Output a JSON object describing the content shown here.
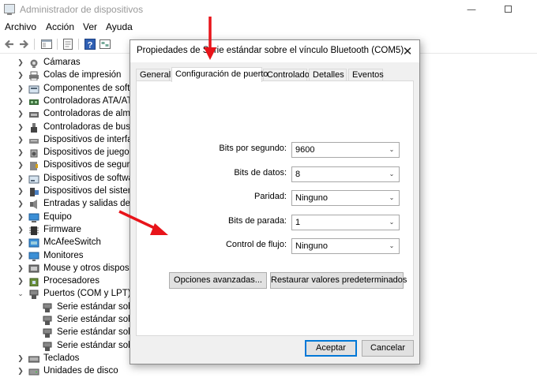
{
  "window": {
    "title": "Administrador de dispositivos",
    "minimize_glyph": "—",
    "close_glyph": "✕"
  },
  "menu": [
    "Archivo",
    "Acción",
    "Ver",
    "Ayuda"
  ],
  "toolbar_icons": [
    "back-arrow-icon",
    "forward-arrow-icon",
    "show-hide-tree-icon",
    "properties-icon",
    "help-icon",
    "device-view-icon"
  ],
  "tree": {
    "expand_glyph": "❯",
    "collapse_glyph": "⌄",
    "items": [
      {
        "label": "Cámaras",
        "icon": "camera-icon",
        "expanded": false
      },
      {
        "label": "Colas de impresión",
        "icon": "printer-icon",
        "expanded": false
      },
      {
        "label": "Componentes de softw",
        "icon": "software-component-icon",
        "expanded": false
      },
      {
        "label": "Controladoras ATA/ATA",
        "icon": "ata-controller-icon",
        "expanded": false
      },
      {
        "label": "Controladoras de alma",
        "icon": "storage-controller-icon",
        "expanded": false
      },
      {
        "label": "Controladoras de bus s",
        "icon": "usb-controller-icon",
        "expanded": false
      },
      {
        "label": "Dispositivos de interfaz",
        "icon": "hid-icon",
        "expanded": false
      },
      {
        "label": "Dispositivos de juego, s",
        "icon": "sound-icon",
        "expanded": false
      },
      {
        "label": "Dispositivos de segurid",
        "icon": "security-device-icon",
        "expanded": false
      },
      {
        "label": "Dispositivos de softwar",
        "icon": "software-device-icon",
        "expanded": false
      },
      {
        "label": "Dispositivos del sistema",
        "icon": "system-device-icon",
        "expanded": false
      },
      {
        "label": "Entradas y salidas de au",
        "icon": "audio-io-icon",
        "expanded": false
      },
      {
        "label": "Equipo",
        "icon": "computer-icon",
        "expanded": false
      },
      {
        "label": "Firmware",
        "icon": "firmware-icon",
        "expanded": false
      },
      {
        "label": "McAfeeSwitch",
        "icon": "network-switch-icon",
        "expanded": false
      },
      {
        "label": "Monitores",
        "icon": "monitor-icon",
        "expanded": false
      },
      {
        "label": "Mouse y otros dispositi",
        "icon": "mouse-icon",
        "expanded": false
      },
      {
        "label": "Procesadores",
        "icon": "processor-icon",
        "expanded": false
      },
      {
        "label": "Puertos (COM y LPT)",
        "icon": "port-icon",
        "expanded": true
      },
      {
        "label": "Serie estándar sobre",
        "icon": "port-icon",
        "child": true
      },
      {
        "label": "Serie estándar sobre",
        "icon": "port-icon",
        "child": true
      },
      {
        "label": "Serie estándar sobre",
        "icon": "port-icon",
        "child": true
      },
      {
        "label": "Serie estándar sobre",
        "icon": "port-icon",
        "child": true
      },
      {
        "label": "Teclados",
        "icon": "keyboard-icon",
        "expanded": false
      },
      {
        "label": "Unidades de disco",
        "icon": "disk-drive-icon",
        "expanded": false
      }
    ]
  },
  "dialog": {
    "title": "Propiedades de Serie estándar sobre el vínculo Bluetooth (COM5)",
    "close_glyph": "✕",
    "tabs": [
      "General",
      "Configuración de puerto",
      "Controlador",
      "Detalles",
      "Eventos"
    ],
    "active_tab": 1,
    "fields": [
      {
        "label": "Bits por segundo:",
        "value": "9600"
      },
      {
        "label": "Bits de datos:",
        "value": "8"
      },
      {
        "label": "Paridad:",
        "value": "Ninguno"
      },
      {
        "label": "Bits de parada:",
        "value": "1"
      },
      {
        "label": "Control de flujo:",
        "value": "Ninguno"
      }
    ],
    "dropdown_glyph": "⌄",
    "advanced_button": "Opciones avanzadas...",
    "restore_button": "Restaurar valores predeterminados",
    "ok_button": "Aceptar",
    "cancel_button": "Cancelar"
  },
  "annotation_color": "#e8141a"
}
